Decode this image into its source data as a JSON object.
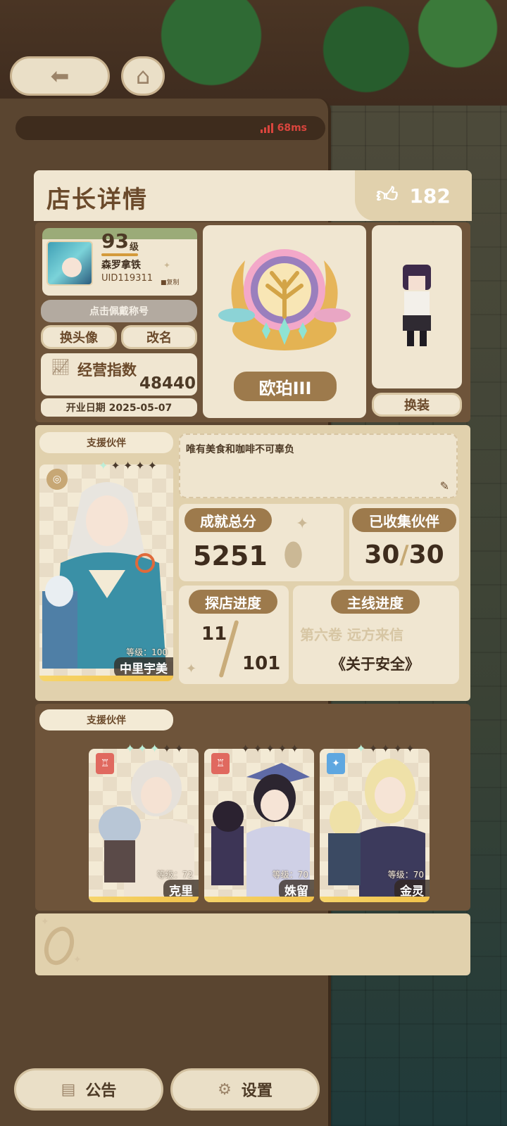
{
  "ping": "68ms",
  "panel": {
    "title": "店长详情",
    "likes": "182"
  },
  "profile": {
    "level": "93",
    "level_unit": "级",
    "name": "森罗拿铁",
    "uid": "UID119311",
    "copy_label": "复制",
    "wear_title_button": "点击佩戴称号",
    "change_avatar_button": "换头像",
    "rename_button": "改名",
    "business_index_label": "经营指数",
    "business_index_value": "48440",
    "open_date": "开业日期 2025-05-07"
  },
  "rank": {
    "name": "欧珀III"
  },
  "outfit_button": "换装",
  "support": {
    "label": "支援伙伴",
    "motto": "唯有美食和咖啡不可辜负",
    "main_partner": {
      "level": "等级：100",
      "name": "中里宇美",
      "stars_on": 1,
      "stars_total": 5
    },
    "achievement_label": "成就总分",
    "achievement_value": "5251",
    "collected_label": "已收集伙伴",
    "collected_value": "30",
    "collected_slash": "/",
    "collected_total": "30",
    "explore_label": "探店进度",
    "explore_value": "11",
    "explore_total": "101",
    "main_story_label": "主线进度",
    "main_story_chapter": "第六卷 远方来信",
    "main_story_title": "《关于安全》"
  },
  "support_team": {
    "label": "支援伙伴",
    "partners": [
      {
        "level": "等级：72",
        "name": "克里",
        "stars_on": 3,
        "stars_total": 5,
        "role_color": "#e0695f"
      },
      {
        "level": "等级：70",
        "name": "姝留",
        "stars_on": 0,
        "stars_total": 5,
        "role_color": "#e0695f"
      },
      {
        "level": "等级：70",
        "name": "金灵",
        "stars_on": 1,
        "stars_total": 5,
        "role_color": "#5fa7e0"
      }
    ]
  },
  "bottom": {
    "notice": "公告",
    "settings": "设置"
  },
  "colors": {
    "panel_bg": "#f0e6d1",
    "section_bg": "#6e543a",
    "tag": "#9d7a4c",
    "ping": "#d9453d",
    "star_on": "#bdeed8"
  }
}
